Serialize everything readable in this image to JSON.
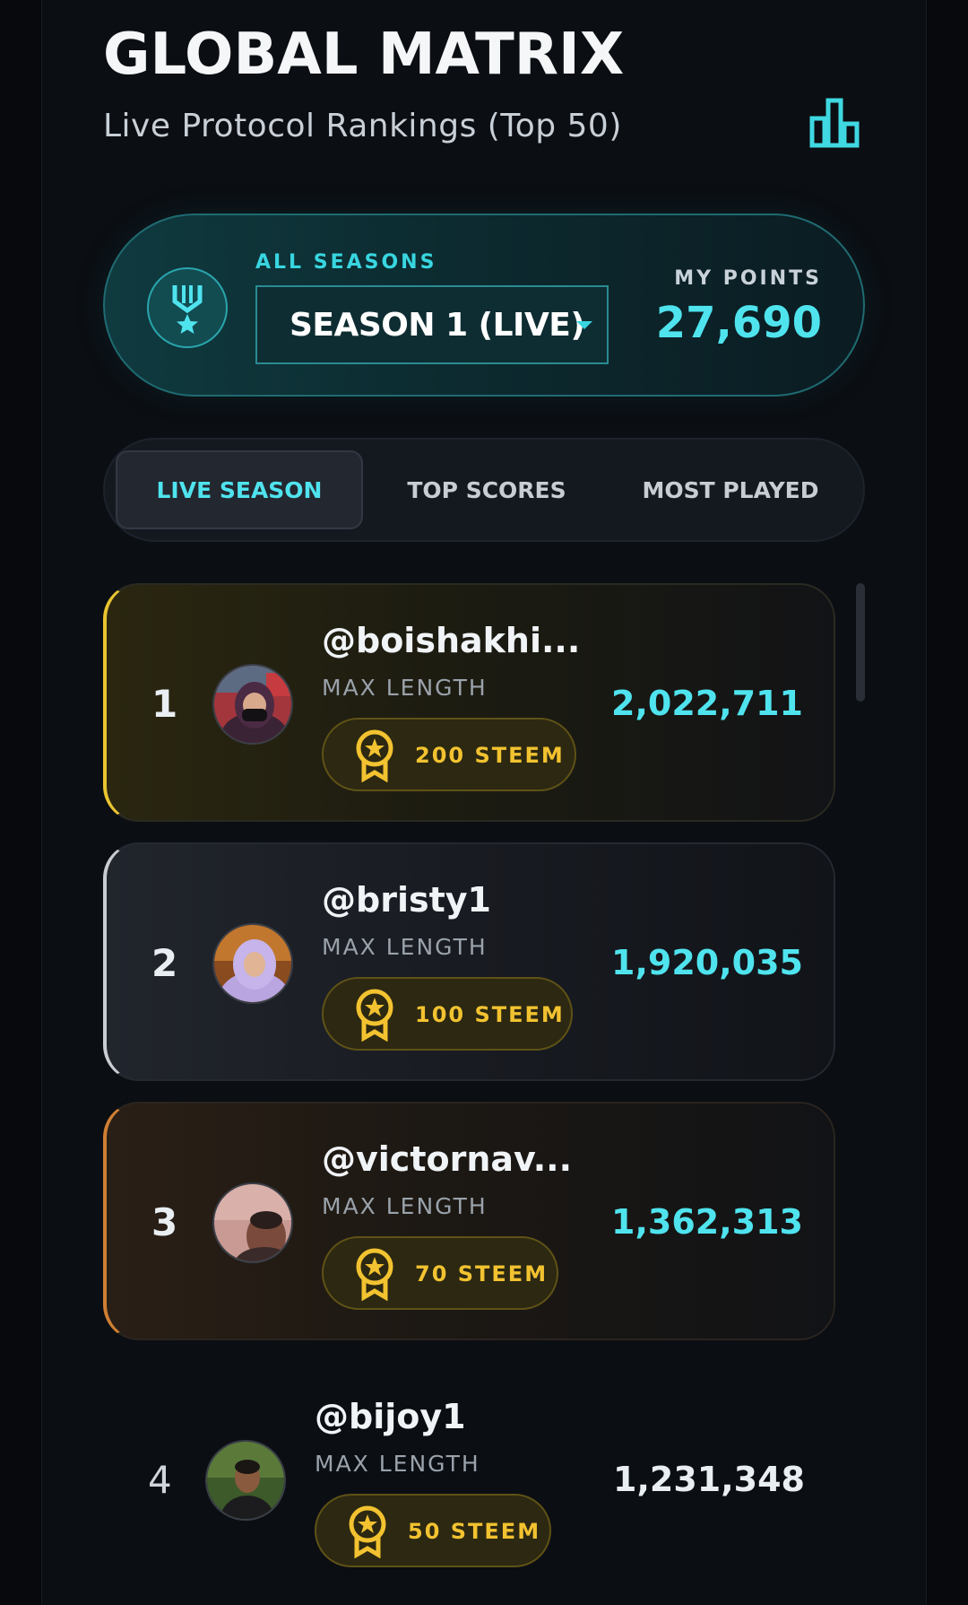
{
  "header": {
    "title": "GLOBAL MATRIX",
    "subtitle": "Live Protocol Rankings (Top 50)",
    "chart_button_icon": "bar-chart-icon"
  },
  "season_card": {
    "icon": "medal-icon",
    "label": "ALL SEASONS",
    "selected_season": "SEASON 1 (LIVE)",
    "my_points_label": "MY POINTS",
    "my_points_value": "27,690"
  },
  "tabs": [
    {
      "label": "LIVE SEASON",
      "active": true
    },
    {
      "label": "TOP SCORES",
      "active": false
    },
    {
      "label": "MOST PLAYED",
      "active": false
    }
  ],
  "leaderboard": [
    {
      "rank": "1",
      "username": "@boishakhi...",
      "metric": "MAX LENGTH",
      "prize": "200 STEEM",
      "score": "2,022,711"
    },
    {
      "rank": "2",
      "username": "@bristy1",
      "metric": "MAX LENGTH",
      "prize": "100 STEEM",
      "score": "1,920,035"
    },
    {
      "rank": "3",
      "username": "@victornav...",
      "metric": "MAX LENGTH",
      "prize": "70 STEEM",
      "score": "1,362,313"
    },
    {
      "rank": "4",
      "username": "@bijoy1",
      "metric": "MAX LENGTH",
      "prize": "50 STEEM",
      "score": "1,231,348"
    }
  ],
  "colors": {
    "accent": "#4fe3ee",
    "gold": "#e8c431",
    "silver": "#c9ccd1",
    "bronze": "#cf7f34",
    "prize_text": "#f2c230"
  }
}
